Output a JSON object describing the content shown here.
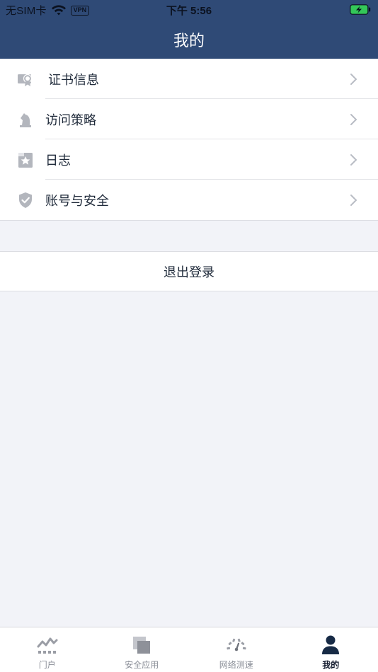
{
  "status_bar": {
    "carrier": "无SIM卡",
    "vpn": "VPN",
    "time": "下午 5:56"
  },
  "nav": {
    "title": "我的"
  },
  "menu": {
    "items": [
      {
        "label": "证书信息",
        "icon": "certificate-icon"
      },
      {
        "label": "访问策略",
        "icon": "chess-knight-icon"
      },
      {
        "label": "日志",
        "icon": "star-note-icon"
      },
      {
        "label": "账号与安全",
        "icon": "shield-check-icon"
      }
    ]
  },
  "logout": {
    "label": "退出登录"
  },
  "tabbar": {
    "active": "我的",
    "tabs": [
      {
        "label": "门户",
        "icon": "activity-chart-icon"
      },
      {
        "label": "安全应用",
        "icon": "stacked-squares-icon"
      },
      {
        "label": "网络测速",
        "icon": "speedometer-icon"
      },
      {
        "label": "我的",
        "icon": "user-icon"
      }
    ]
  },
  "colors": {
    "header_bg": "#2f4a76",
    "page_bg": "#f2f3f8",
    "text_primary": "#1f2a3a",
    "tab_inactive": "#8b8f98",
    "tab_active": "#0f172a",
    "battery": "#34c759"
  }
}
